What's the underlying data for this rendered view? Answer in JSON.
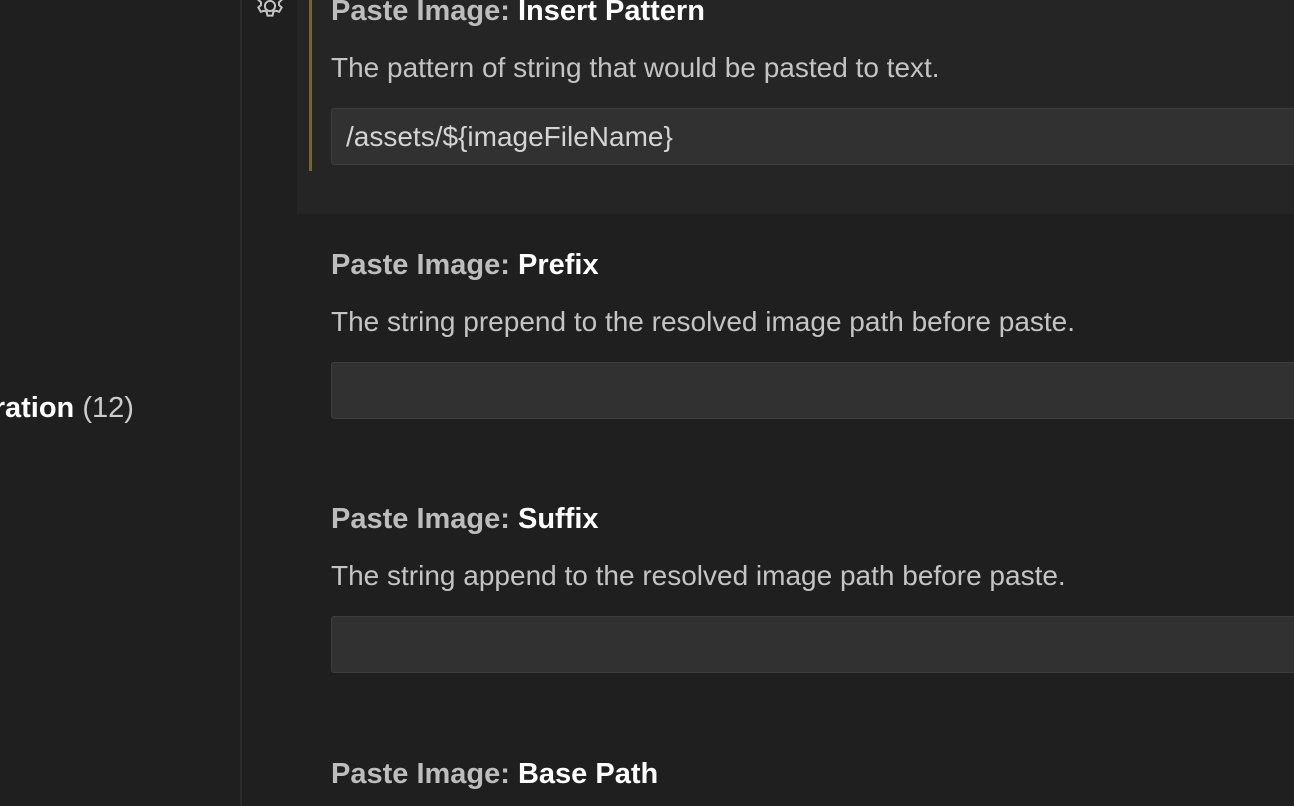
{
  "toc": {
    "item_name": "uration",
    "item_count": "(12)"
  },
  "settings": [
    {
      "category": "Paste Image: ",
      "key": "Insert Pattern",
      "description": "The pattern of string that would be pasted to text.",
      "value": "/assets/${imageFileName}"
    },
    {
      "category": "Paste Image: ",
      "key": "Prefix",
      "description": "The string prepend to the resolved image path before paste.",
      "value": ""
    },
    {
      "category": "Paste Image: ",
      "key": "Suffix",
      "description": "The string append to the resolved image path before paste.",
      "value": ""
    },
    {
      "category": "Paste Image: ",
      "key": "Base Path"
    }
  ],
  "colors": {
    "background": "#1f1f1f",
    "focused_row": "#252526",
    "focus_bar": "#7a6534",
    "input_background": "#313131"
  },
  "icons": {
    "settings_gear": "gear-icon"
  }
}
